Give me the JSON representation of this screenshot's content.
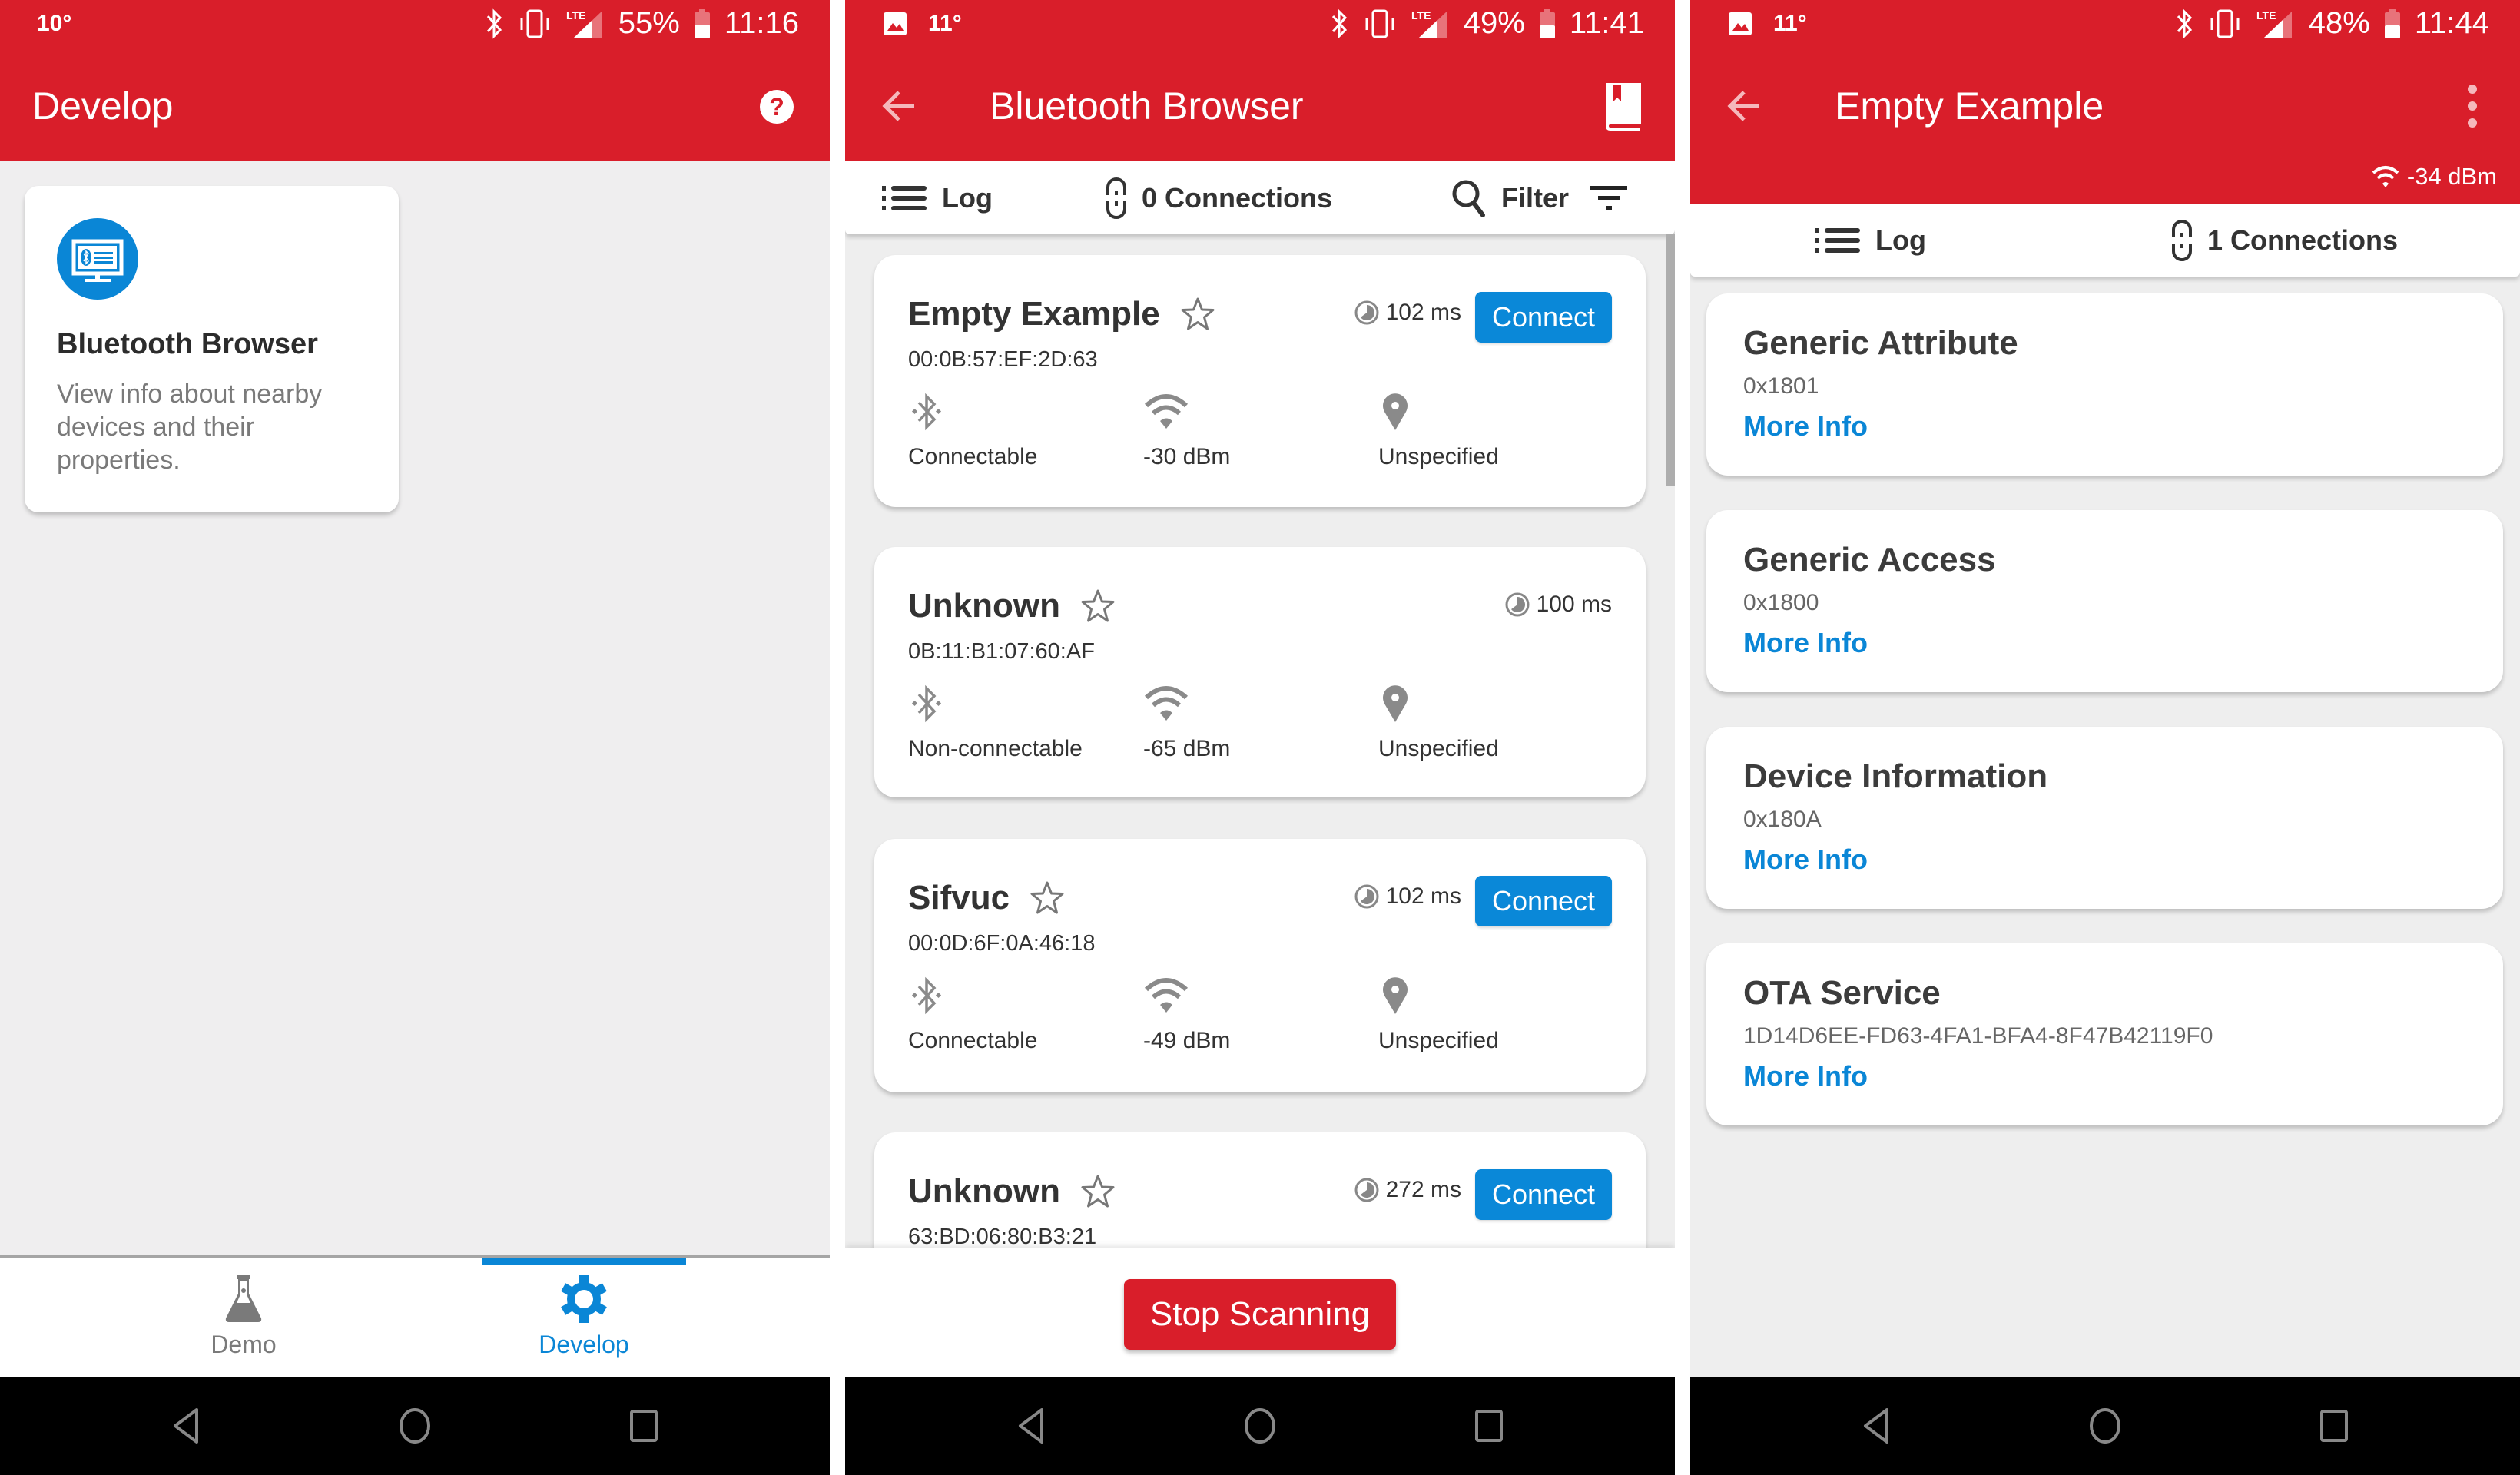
{
  "colors": {
    "brand_red": "#d91e2a",
    "accent_blue": "#0a86d6",
    "background": "#eeeeee",
    "text_dark": "#333333",
    "text_muted": "#7a7a7a"
  },
  "screens": [
    {
      "status_bar": {
        "left_text": "10°",
        "battery": "55%",
        "time": "11:16",
        "icons": [
          "bluetooth-icon",
          "vibrate-icon",
          "lte-signal-icon",
          "battery-icon"
        ]
      },
      "app_bar": {
        "title": "Develop",
        "action_icon": "help-icon"
      },
      "feature_card": {
        "icon": "bluetooth-browser-icon",
        "title": "Bluetooth Browser",
        "description": "View info about nearby devices and their properties."
      },
      "bottom_nav": {
        "items": [
          {
            "label": "Demo",
            "icon": "flask-icon",
            "selected": false
          },
          {
            "label": "Develop",
            "icon": "gear-icon",
            "selected": true
          }
        ]
      },
      "system_nav": [
        "back-icon",
        "home-icon",
        "recents-icon"
      ]
    },
    {
      "status_bar": {
        "left_text": "11°",
        "battery": "49%",
        "time": "11:41",
        "icons": [
          "image-icon",
          "bluetooth-icon",
          "vibrate-icon",
          "lte-signal-icon",
          "battery-icon"
        ]
      },
      "app_bar": {
        "title": "Bluetooth Browser",
        "back_icon": "arrow-back-icon",
        "action_icon": "book-icon"
      },
      "toolbar": {
        "log_label": "Log",
        "connections_label": "0 Connections",
        "filter_label": "Filter"
      },
      "devices": [
        {
          "name": "Empty Example",
          "address": "00:0B:57:EF:2D:63",
          "interval": "102 ms",
          "connect_label": "Connect",
          "connectable": "Connectable",
          "rssi": "-30 dBm",
          "bonding": "Unspecified",
          "favorite": false
        },
        {
          "name": "Unknown",
          "address": "0B:11:B1:07:60:AF",
          "interval": "100 ms",
          "connect_label": null,
          "connectable": "Non-connectable",
          "rssi": "-65 dBm",
          "bonding": "Unspecified",
          "favorite": false
        },
        {
          "name": "Sifvuc",
          "address": "00:0D:6F:0A:46:18",
          "interval": "102 ms",
          "connect_label": "Connect",
          "connectable": "Connectable",
          "rssi": "-49 dBm",
          "bonding": "Unspecified",
          "favorite": false
        },
        {
          "name": "Unknown",
          "address": "63:BD:06:80:B3:21",
          "interval": "272 ms",
          "connect_label": "Connect",
          "favorite": false
        }
      ],
      "stop_button_label": "Stop Scanning",
      "system_nav": [
        "back-icon",
        "home-icon",
        "recents-icon"
      ]
    },
    {
      "status_bar": {
        "left_text": "11°",
        "battery": "48%",
        "time": "11:44",
        "icons": [
          "image-icon",
          "bluetooth-icon",
          "vibrate-icon",
          "lte-signal-icon",
          "battery-icon"
        ]
      },
      "app_bar": {
        "title": "Empty Example",
        "back_icon": "arrow-back-icon",
        "action_icon": "more-vert-icon",
        "rssi": "-34 dBm"
      },
      "toolbar": {
        "log_label": "Log",
        "connections_label": "1 Connections"
      },
      "services": [
        {
          "name": "Generic Attribute",
          "uuid": "0x1801",
          "more_label": "More Info"
        },
        {
          "name": "Generic Access",
          "uuid": "0x1800",
          "more_label": "More Info"
        },
        {
          "name": "Device Information",
          "uuid": "0x180A",
          "more_label": "More Info"
        },
        {
          "name": "OTA Service",
          "uuid": "1D14D6EE-FD63-4FA1-BFA4-8F47B42119F0",
          "more_label": "More Info"
        }
      ],
      "system_nav": [
        "back-icon",
        "home-icon",
        "recents-icon"
      ]
    }
  ]
}
